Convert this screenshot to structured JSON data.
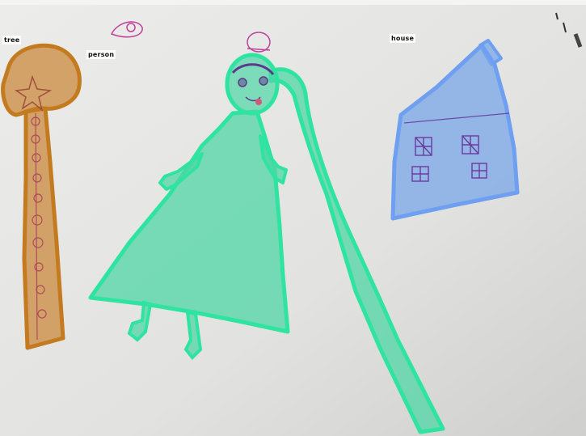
{
  "labels": {
    "tree": "tree",
    "person": "person",
    "house": "house"
  },
  "colors": {
    "tree_fill": "#c98a3e",
    "tree_stroke": "#c47a1e",
    "person_fill": "#4fd6a6",
    "person_stroke": "#2fe3a0",
    "house_fill": "#7aa7e8",
    "house_stroke": "#6e9ff0",
    "paper": "#e6e6e4",
    "pencil_purple": "#7a3fa0",
    "pencil_pink": "#c0409a"
  }
}
